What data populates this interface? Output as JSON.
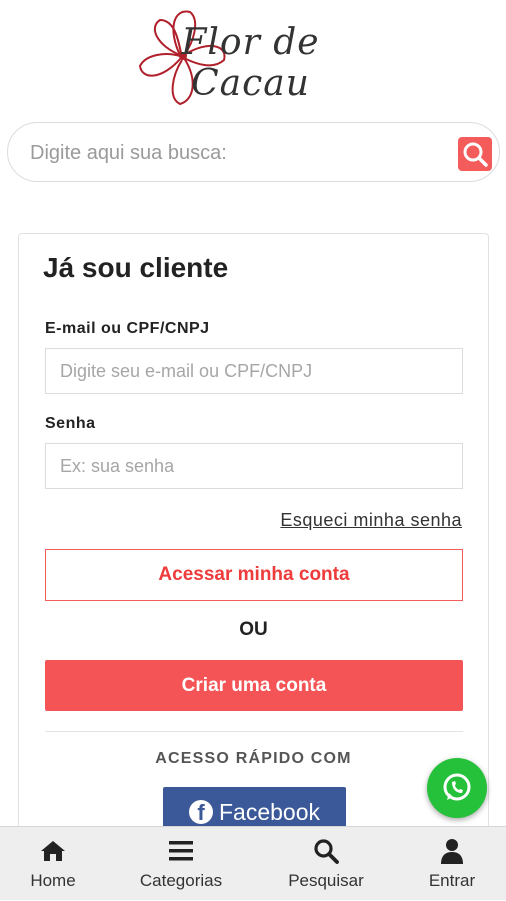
{
  "logo": {
    "text": "Flor de Cacau"
  },
  "search": {
    "placeholder": "Digite aqui sua busca:"
  },
  "login": {
    "title": "Já sou cliente",
    "email_label": "E-mail ou CPF/CNPJ",
    "email_placeholder": "Digite seu e-mail ou CPF/CNPJ",
    "password_label": "Senha",
    "password_placeholder": "Ex: sua senha",
    "forgot_link": "Esqueci minha senha",
    "access_button": "Acessar minha conta",
    "or_text": "OU",
    "create_button": "Criar uma conta",
    "quick_access": "ACESSO RÁPIDO COM",
    "facebook_button": "Facebook"
  },
  "bottom_nav": {
    "items": [
      {
        "label": "Home",
        "icon": "home-icon"
      },
      {
        "label": "Categorias",
        "icon": "menu-icon"
      },
      {
        "label": "Pesquisar",
        "icon": "search-icon"
      },
      {
        "label": "Entrar",
        "icon": "user-icon"
      }
    ]
  },
  "colors": {
    "accent": "#f45456",
    "facebook": "#3b5998",
    "whatsapp": "#25c13a"
  }
}
